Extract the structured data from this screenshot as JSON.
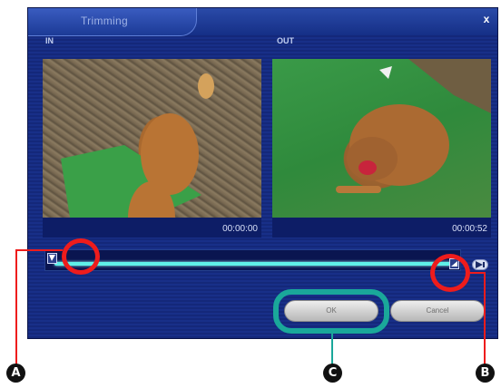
{
  "dialog": {
    "title": "Trimming",
    "close_label": "x"
  },
  "in_pane": {
    "label": "IN",
    "time": "00:00:00"
  },
  "out_pane": {
    "label": "OUT",
    "time": "00:00:52"
  },
  "trim_slider": {
    "in_position_fraction": 0.0,
    "out_position_fraction": 1.0
  },
  "buttons": {
    "ok_label": "OK",
    "cancel_label": "Cancel"
  },
  "callouts": {
    "a": "A",
    "b": "B",
    "c": "C"
  },
  "colors": {
    "highlight_red": "#ee1c1c",
    "highlight_teal": "#1aa89a",
    "slider_track": "#5ff0e8"
  }
}
